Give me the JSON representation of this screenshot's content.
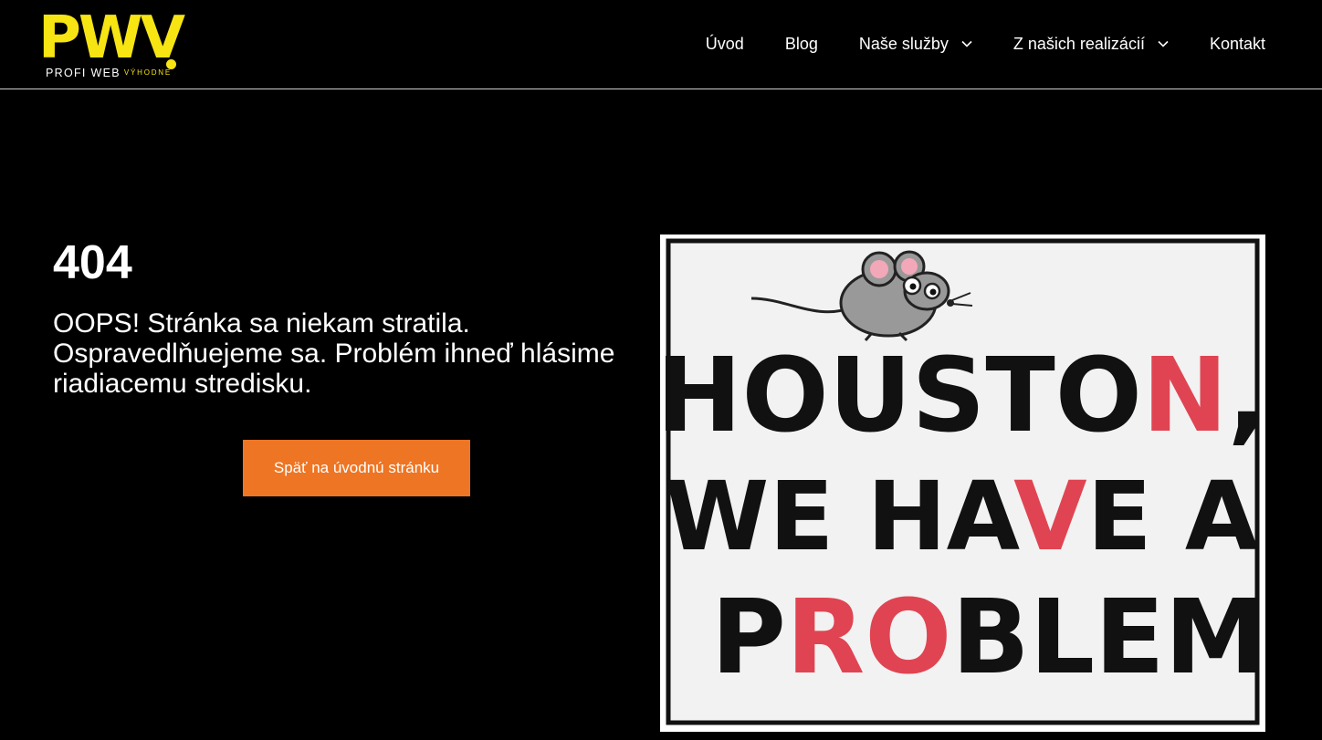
{
  "brand": {
    "logo_letters": "PWV",
    "tagline_main": "PROFI WEB",
    "tagline_accent": "VÝHODNE",
    "color": "#f7e413"
  },
  "nav": {
    "items": [
      {
        "label": "Úvod",
        "has_dropdown": false
      },
      {
        "label": "Blog",
        "has_dropdown": false
      },
      {
        "label": "Naše služby",
        "has_dropdown": true
      },
      {
        "label": "Z našich realizácií",
        "has_dropdown": true
      },
      {
        "label": "Kontakt",
        "has_dropdown": false
      }
    ]
  },
  "hero": {
    "code": "404",
    "message": "OOPS! Stránka sa niekam stratila. Ospravedlňuejeme sa. Problém ihneď hlásime riadiacemu stredisku.",
    "button_label": "Späť na úvodnú stránku",
    "button_color": "#ee7523"
  },
  "poster": {
    "lines": [
      {
        "text": "HOUSTON,",
        "highlight": "N"
      },
      {
        "text": "WE HAVE A",
        "highlight": "V"
      },
      {
        "text": "PROBLEM",
        "highlight": "RO"
      }
    ],
    "highlight_color": "#e04452",
    "mascot": "mouse-icon"
  }
}
